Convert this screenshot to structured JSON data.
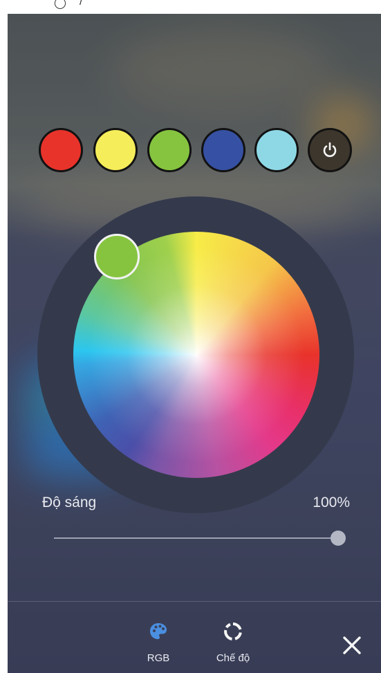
{
  "presets": [
    {
      "name": "red",
      "color": "#e8332b"
    },
    {
      "name": "yellow",
      "color": "#f6ed5a"
    },
    {
      "name": "green",
      "color": "#86c440"
    },
    {
      "name": "blue",
      "color": "#3651a3"
    },
    {
      "name": "cyan",
      "color": "#8ed8e6"
    }
  ],
  "power": {
    "icon": "power-icon"
  },
  "color_wheel": {
    "selected_color": "#86c440"
  },
  "brightness": {
    "label": "Độ sáng",
    "value_text": "100%",
    "level": 1.0
  },
  "nav": {
    "rgb": {
      "label": "RGB",
      "icon": "palette-icon",
      "color": "#4a8fe0"
    },
    "mode": {
      "label": "Chế độ",
      "icon": "mode-ring-icon"
    },
    "close": {
      "icon": "close-icon"
    }
  }
}
